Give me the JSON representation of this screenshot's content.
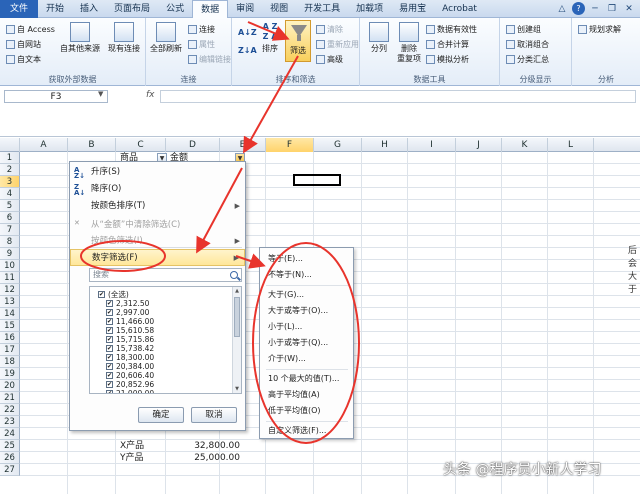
{
  "tabs": [
    "文件",
    "开始",
    "插入",
    "页面布局",
    "公式",
    "数据",
    "审阅",
    "视图",
    "开发工具",
    "加载项",
    "易用宝",
    "Acrobat"
  ],
  "active_tab": "数据",
  "window_controls": {
    "help": "?",
    "minimize": "─",
    "restore": "❐",
    "close": "✕"
  },
  "ribbon": {
    "external": {
      "access": "自 Access",
      "web": "自网站",
      "text": "自文本",
      "other": "自其他来源",
      "existing": "现有连接",
      "label": "获取外部数据"
    },
    "connections": {
      "refresh": "全部刷新",
      "connect": "连接",
      "properties": "属性",
      "edit_links": "编辑链接",
      "label": "连接"
    },
    "sort_filter": {
      "sort": "排序",
      "filter": "筛选",
      "clear": "清除",
      "reapply": "重新应用",
      "advanced": "高级",
      "label": "排序和筛选"
    },
    "data_tools": {
      "split": "分列",
      "remove_dup": "删除\n重复项",
      "validation": "数据有效性",
      "consolidate": "合并计算",
      "whatif": "模拟分析",
      "label": "数据工具"
    },
    "outline": {
      "group": "创建组",
      "ungroup": "取消组合",
      "subtotal": "分类汇总",
      "label": "分级显示"
    },
    "analysis": {
      "solver": "规划求解",
      "label": "分析"
    }
  },
  "name_box": "F3",
  "fx_label": "fx",
  "formula_value": "",
  "columns": [
    "A",
    "B",
    "C",
    "D",
    "E",
    "F",
    "G",
    "H",
    "I",
    "J",
    "K",
    "L"
  ],
  "selected_column": "F",
  "rows": [
    "1",
    "2",
    "3",
    "4",
    "5",
    "6",
    "7",
    "8",
    "9",
    "10",
    "11",
    "12",
    "13",
    "14",
    "15",
    "16",
    "17",
    "18",
    "19",
    "20",
    "21",
    "22",
    "23",
    "24",
    "25",
    "26",
    "27"
  ],
  "selected_row": "3",
  "header_cells": {
    "c1": "商品",
    "d1": "金额"
  },
  "bottom_rows": [
    {
      "name": "X产品",
      "amount": "32,800.00"
    },
    {
      "name": "Y产品",
      "amount": "25,000.00"
    }
  ],
  "filter_menu": {
    "sort_asc": "升序(S)",
    "sort_desc": "降序(O)",
    "sort_color": "按颜色排序(T)",
    "clear_filter": "从“金额”中清除筛选(C)",
    "color_filter": "按颜色筛选(I)",
    "number_filter": "数字筛选(F)",
    "search_placeholder": "搜索",
    "list": [
      "(全选)",
      "2,312.50",
      "2,997.00",
      "11,466.00",
      "15,610.58",
      "15,715.86",
      "15,738.42",
      "18,300.00",
      "20,384.00",
      "20,606.40",
      "20,852.96",
      "21,000.00"
    ],
    "ok": "确定",
    "cancel": "取消"
  },
  "number_submenu": [
    "等于(E)...",
    "不等于(N)...",
    "大于(G)...",
    "大于或等于(O)...",
    "小于(L)...",
    "小于或等于(Q)...",
    "介于(W)...",
    "10 个最大的值(T)...",
    "高于平均值(A)",
    "低于平均值(O)",
    "自定义筛选(F)..."
  ],
  "edge_text": [
    "后会",
    "大于"
  ],
  "watermark": "头条 @程序员小新人学习",
  "colors": {
    "accent": "#e8342c",
    "file_tab": "#2a64b8",
    "highlight": "#ffe79a"
  }
}
